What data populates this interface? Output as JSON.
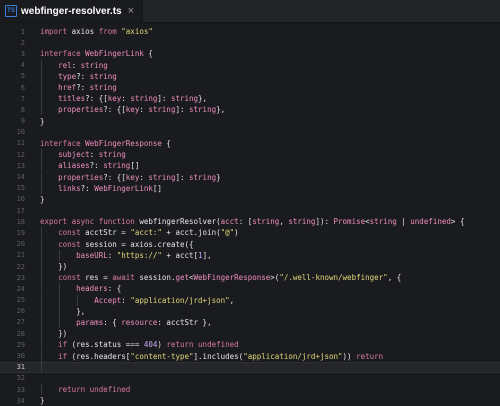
{
  "tab": {
    "title": "webfinger-resolver.ts",
    "icon": "typescript-file-icon",
    "close_glyph": "×"
  },
  "colors": {
    "keyword": "#d97aa5",
    "string": "#e2d97a",
    "type": "#f08fc0",
    "number": "#c9a8f5",
    "text": "#e6e6e6"
  },
  "current_line": 31,
  "lines": [
    {
      "n": "1",
      "i": 0,
      "tokens": [
        {
          "t": "import",
          "c": "kw"
        },
        {
          "t": " axios ",
          "c": ""
        },
        {
          "t": "from",
          "c": "kw"
        },
        {
          "t": " ",
          "c": ""
        },
        {
          "t": "\"axios\"",
          "c": "str"
        }
      ]
    },
    {
      "n": "2",
      "i": 0,
      "tokens": []
    },
    {
      "n": "3",
      "i": 0,
      "tokens": [
        {
          "t": "interface",
          "c": "kw"
        },
        {
          "t": " ",
          "c": ""
        },
        {
          "t": "WebFingerLink",
          "c": "type"
        },
        {
          "t": " {",
          "c": ""
        }
      ]
    },
    {
      "n": "4",
      "i": 1,
      "tokens": [
        {
          "t": "rel",
          "c": "type"
        },
        {
          "t": ": ",
          "c": ""
        },
        {
          "t": "string",
          "c": "type"
        }
      ]
    },
    {
      "n": "5",
      "i": 1,
      "tokens": [
        {
          "t": "type",
          "c": "type"
        },
        {
          "t": "?: ",
          "c": ""
        },
        {
          "t": "string",
          "c": "type"
        }
      ]
    },
    {
      "n": "6",
      "i": 1,
      "tokens": [
        {
          "t": "href",
          "c": "type"
        },
        {
          "t": "?: ",
          "c": ""
        },
        {
          "t": "string",
          "c": "type"
        }
      ]
    },
    {
      "n": "7",
      "i": 1,
      "tokens": [
        {
          "t": "titles",
          "c": "type"
        },
        {
          "t": "?: {[",
          "c": ""
        },
        {
          "t": "key",
          "c": "type"
        },
        {
          "t": ": ",
          "c": ""
        },
        {
          "t": "string",
          "c": "type"
        },
        {
          "t": "]: ",
          "c": ""
        },
        {
          "t": "string",
          "c": "type"
        },
        {
          "t": "},",
          "c": ""
        }
      ]
    },
    {
      "n": "8",
      "i": 1,
      "tokens": [
        {
          "t": "properties",
          "c": "type"
        },
        {
          "t": "?: {[",
          "c": ""
        },
        {
          "t": "key",
          "c": "type"
        },
        {
          "t": ": ",
          "c": ""
        },
        {
          "t": "string",
          "c": "type"
        },
        {
          "t": "]: ",
          "c": ""
        },
        {
          "t": "string",
          "c": "type"
        },
        {
          "t": "},",
          "c": ""
        }
      ]
    },
    {
      "n": "9",
      "i": 0,
      "tokens": [
        {
          "t": "}",
          "c": ""
        }
      ]
    },
    {
      "n": "10",
      "i": 0,
      "tokens": []
    },
    {
      "n": "11",
      "i": 0,
      "tokens": [
        {
          "t": "interface",
          "c": "kw"
        },
        {
          "t": " ",
          "c": ""
        },
        {
          "t": "WebFingerResponse",
          "c": "type"
        },
        {
          "t": " {",
          "c": ""
        }
      ]
    },
    {
      "n": "12",
      "i": 1,
      "tokens": [
        {
          "t": "subject",
          "c": "type"
        },
        {
          "t": ": ",
          "c": ""
        },
        {
          "t": "string",
          "c": "type"
        }
      ]
    },
    {
      "n": "13",
      "i": 1,
      "tokens": [
        {
          "t": "aliases",
          "c": "type"
        },
        {
          "t": "?: ",
          "c": ""
        },
        {
          "t": "string",
          "c": "type"
        },
        {
          "t": "[]",
          "c": ""
        }
      ]
    },
    {
      "n": "14",
      "i": 1,
      "tokens": [
        {
          "t": "properties",
          "c": "type"
        },
        {
          "t": "?: {[",
          "c": ""
        },
        {
          "t": "key",
          "c": "type"
        },
        {
          "t": ": ",
          "c": ""
        },
        {
          "t": "string",
          "c": "type"
        },
        {
          "t": "]: ",
          "c": ""
        },
        {
          "t": "string",
          "c": "type"
        },
        {
          "t": "}",
          "c": ""
        }
      ]
    },
    {
      "n": "15",
      "i": 1,
      "tokens": [
        {
          "t": "links",
          "c": "type"
        },
        {
          "t": "?: ",
          "c": ""
        },
        {
          "t": "WebFingerLink",
          "c": "type"
        },
        {
          "t": "[]",
          "c": ""
        }
      ]
    },
    {
      "n": "16",
      "i": 0,
      "tokens": [
        {
          "t": "}",
          "c": ""
        }
      ]
    },
    {
      "n": "17",
      "i": 0,
      "tokens": []
    },
    {
      "n": "18",
      "i": 0,
      "tokens": [
        {
          "t": "export",
          "c": "kw"
        },
        {
          "t": " ",
          "c": ""
        },
        {
          "t": "async",
          "c": "kw"
        },
        {
          "t": " ",
          "c": ""
        },
        {
          "t": "function",
          "c": "kw"
        },
        {
          "t": " ",
          "c": ""
        },
        {
          "t": "webfingerResolver",
          "c": "fn"
        },
        {
          "t": "(",
          "c": ""
        },
        {
          "t": "acct",
          "c": "type"
        },
        {
          "t": ": [",
          "c": ""
        },
        {
          "t": "string",
          "c": "type"
        },
        {
          "t": ", ",
          "c": ""
        },
        {
          "t": "string",
          "c": "type"
        },
        {
          "t": "]): ",
          "c": ""
        },
        {
          "t": "Promise",
          "c": "type"
        },
        {
          "t": "<",
          "c": ""
        },
        {
          "t": "string",
          "c": "type"
        },
        {
          "t": " | ",
          "c": ""
        },
        {
          "t": "undefined",
          "c": "type"
        },
        {
          "t": "> {",
          "c": ""
        }
      ]
    },
    {
      "n": "19",
      "i": 1,
      "tokens": [
        {
          "t": "const",
          "c": "kw"
        },
        {
          "t": " acctStr = ",
          "c": ""
        },
        {
          "t": "\"acct:\"",
          "c": "str"
        },
        {
          "t": " + acct.join(",
          "c": ""
        },
        {
          "t": "\"@\"",
          "c": "str"
        },
        {
          "t": ")",
          "c": ""
        }
      ]
    },
    {
      "n": "20",
      "i": 1,
      "tokens": [
        {
          "t": "const",
          "c": "kw"
        },
        {
          "t": " session = axios.create({",
          "c": ""
        }
      ]
    },
    {
      "n": "21",
      "i": 2,
      "tokens": [
        {
          "t": "baseURL",
          "c": "type"
        },
        {
          "t": ": ",
          "c": ""
        },
        {
          "t": "\"https://\"",
          "c": "str"
        },
        {
          "t": " + acct[",
          "c": ""
        },
        {
          "t": "1",
          "c": "num"
        },
        {
          "t": "],",
          "c": ""
        }
      ]
    },
    {
      "n": "22",
      "i": 1,
      "tokens": [
        {
          "t": "})",
          "c": ""
        }
      ]
    },
    {
      "n": "23",
      "i": 1,
      "tokens": [
        {
          "t": "const",
          "c": "kw"
        },
        {
          "t": " res = ",
          "c": ""
        },
        {
          "t": "await",
          "c": "kw"
        },
        {
          "t": " session.",
          "c": ""
        },
        {
          "t": "get",
          "c": "type"
        },
        {
          "t": "<",
          "c": ""
        },
        {
          "t": "WebFingerResponse",
          "c": "type"
        },
        {
          "t": ">(",
          "c": ""
        },
        {
          "t": "\"/.well-known/webfinger\"",
          "c": "str"
        },
        {
          "t": ", {",
          "c": ""
        }
      ]
    },
    {
      "n": "24",
      "i": 2,
      "tokens": [
        {
          "t": "headers",
          "c": "type"
        },
        {
          "t": ": {",
          "c": ""
        }
      ]
    },
    {
      "n": "25",
      "i": 3,
      "tokens": [
        {
          "t": "Accept",
          "c": "type"
        },
        {
          "t": ": ",
          "c": ""
        },
        {
          "t": "\"application/jrd+json\"",
          "c": "str"
        },
        {
          "t": ",",
          "c": ""
        }
      ]
    },
    {
      "n": "26",
      "i": 2,
      "tokens": [
        {
          "t": "},",
          "c": ""
        }
      ]
    },
    {
      "n": "27",
      "i": 2,
      "tokens": [
        {
          "t": "params",
          "c": "type"
        },
        {
          "t": ": { ",
          "c": ""
        },
        {
          "t": "resource",
          "c": "type"
        },
        {
          "t": ": acctStr },",
          "c": ""
        }
      ]
    },
    {
      "n": "28",
      "i": 1,
      "tokens": [
        {
          "t": "})",
          "c": ""
        }
      ]
    },
    {
      "n": "29",
      "i": 1,
      "tokens": [
        {
          "t": "if",
          "c": "kw"
        },
        {
          "t": " (res.status === ",
          "c": ""
        },
        {
          "t": "404",
          "c": "num"
        },
        {
          "t": ") ",
          "c": ""
        },
        {
          "t": "return",
          "c": "kw"
        },
        {
          "t": " ",
          "c": ""
        },
        {
          "t": "undefined",
          "c": "kw"
        }
      ]
    },
    {
      "n": "30",
      "i": 1,
      "tokens": [
        {
          "t": "if",
          "c": "kw"
        },
        {
          "t": " (res.headers[",
          "c": ""
        },
        {
          "t": "\"content-type\"",
          "c": "str"
        },
        {
          "t": "].includes(",
          "c": ""
        },
        {
          "t": "\"application/jrd+json\"",
          "c": "str"
        },
        {
          "t": ")) ",
          "c": ""
        },
        {
          "t": "return",
          "c": "kw"
        }
      ]
    },
    {
      "n": "31",
      "i": 1,
      "tokens": []
    },
    {
      "n": "32",
      "i": 0,
      "tokens": []
    },
    {
      "n": "33",
      "i": 1,
      "tokens": [
        {
          "t": "return",
          "c": "kw"
        },
        {
          "t": " ",
          "c": ""
        },
        {
          "t": "undefined",
          "c": "kw"
        }
      ]
    },
    {
      "n": "34",
      "i": 0,
      "tokens": [
        {
          "t": "}",
          "c": ""
        }
      ]
    }
  ]
}
